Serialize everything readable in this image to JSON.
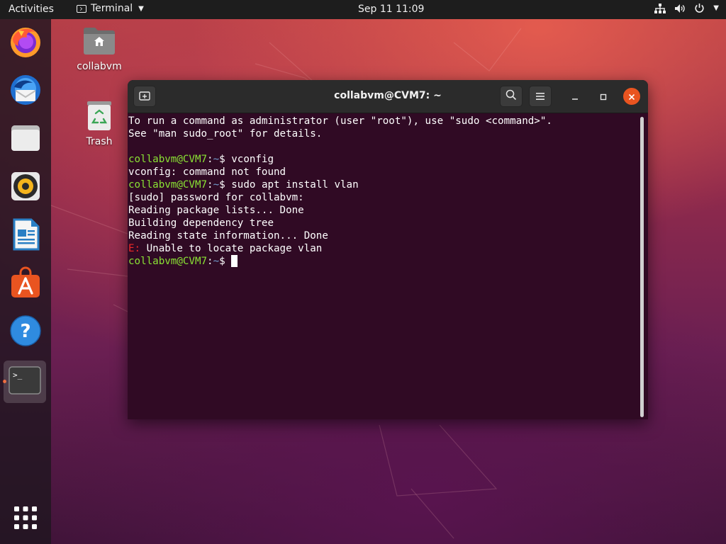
{
  "topbar": {
    "activities": "Activities",
    "app_name": "Terminal",
    "clock": "Sep 11  11:09"
  },
  "dock": {
    "items": [
      {
        "name": "Firefox"
      },
      {
        "name": "Thunderbird"
      },
      {
        "name": "Files"
      },
      {
        "name": "Rhythmbox"
      },
      {
        "name": "LibreOffice Writer"
      },
      {
        "name": "Ubuntu Software"
      },
      {
        "name": "Help"
      },
      {
        "name": "Terminal",
        "running": true,
        "prompt_glyph": ">_"
      },
      {
        "name": "Show Applications"
      }
    ]
  },
  "desktop": {
    "home_label": "collabvm",
    "trash_label": "Trash"
  },
  "terminal": {
    "title": "collabvm@CVM7: ~",
    "lines": [
      {
        "type": "out",
        "text": "To run a command as administrator (user \"root\"), use \"sudo <command>\"."
      },
      {
        "type": "out",
        "text": "See \"man sudo_root\" for details."
      },
      {
        "type": "blank",
        "text": ""
      },
      {
        "type": "prompt",
        "user": "collabvm@CVM7",
        "sep": ":",
        "path": "~",
        "sym": "$ ",
        "cmd": "vconfig"
      },
      {
        "type": "out",
        "text": "vconfig: command not found"
      },
      {
        "type": "prompt",
        "user": "collabvm@CVM7",
        "sep": ":",
        "path": "~",
        "sym": "$ ",
        "cmd": "sudo apt install vlan"
      },
      {
        "type": "out",
        "text": "[sudo] password for collabvm:"
      },
      {
        "type": "out",
        "text": "Reading package lists... Done"
      },
      {
        "type": "out",
        "text": "Building dependency tree"
      },
      {
        "type": "out",
        "text": "Reading state information... Done"
      },
      {
        "type": "error",
        "prefix": "E:",
        "text": " Unable to locate package vlan"
      },
      {
        "type": "prompt",
        "user": "collabvm@CVM7",
        "sep": ":",
        "path": "~",
        "sym": "$ ",
        "cmd": "",
        "cursor": true
      }
    ]
  },
  "colors": {
    "accent": "#e95420",
    "terminal_bg": "#300a24",
    "prompt_user": "#8ae234",
    "prompt_path": "#729fcf",
    "error": "#ef2929"
  }
}
